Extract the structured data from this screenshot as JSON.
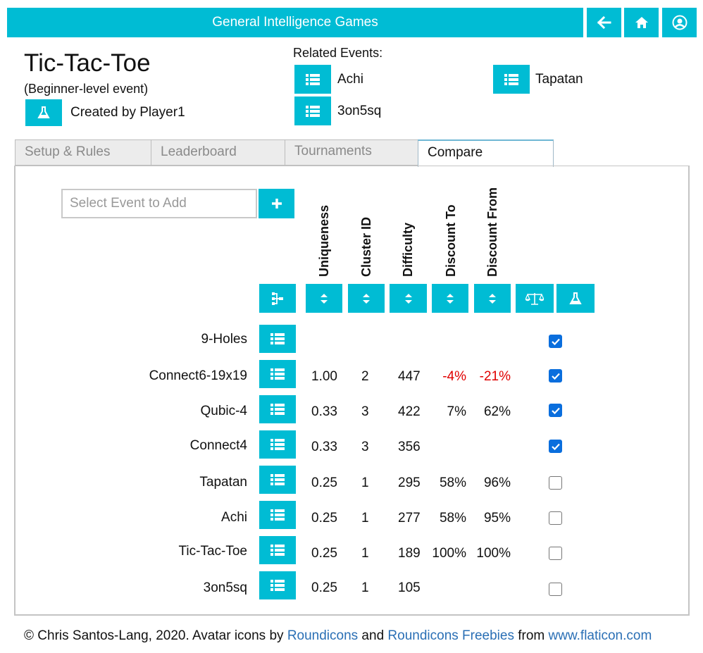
{
  "header": {
    "title": "General Intelligence Games",
    "icons": [
      "back-arrow-icon",
      "home-icon",
      "user-account-icon"
    ]
  },
  "event": {
    "title": "Tic-Tac-Toe",
    "level": "(Beginner-level event)",
    "creator_text": "Created by Player1",
    "creator_icon": "flask-icon"
  },
  "related": {
    "label": "Related Events:",
    "items": [
      {
        "name": "Achi"
      },
      {
        "name": "Tapatan"
      },
      {
        "name": "3on5sq"
      }
    ]
  },
  "tabs": [
    {
      "label": "Setup & Rules"
    },
    {
      "label": "Leaderboard"
    },
    {
      "label": "Tournaments"
    },
    {
      "label": "Compare",
      "active": true
    }
  ],
  "compare": {
    "search_placeholder": "Select Event to Add",
    "add_icon": "plus-icon",
    "columns": [
      "Uniqueness",
      "Cluster ID",
      "Difficulty",
      "Discount To",
      "Discount From"
    ],
    "sort_icons": [
      "hierarchy-icon",
      "sort-icon",
      "sort-icon",
      "sort-icon",
      "sort-icon",
      "sort-icon",
      "balance-scale-icon",
      "flask-icon"
    ],
    "rows": [
      {
        "name": "9-Holes",
        "uniqueness": "",
        "cluster": "",
        "difficulty": "",
        "discount_to": "",
        "discount_from": "",
        "checked": true
      },
      {
        "name": "Connect6-19x19",
        "uniqueness": "1.00",
        "cluster": "2",
        "difficulty": "447",
        "discount_to": "-4%",
        "discount_from": "-21%",
        "checked": true
      },
      {
        "name": "Qubic-4",
        "uniqueness": "0.33",
        "cluster": "3",
        "difficulty": "422",
        "discount_to": "7%",
        "discount_from": "62%",
        "checked": true
      },
      {
        "name": "Connect4",
        "uniqueness": "0.33",
        "cluster": "3",
        "difficulty": "356",
        "discount_to": "",
        "discount_from": "",
        "checked": true
      },
      {
        "name": "Tapatan",
        "uniqueness": "0.25",
        "cluster": "1",
        "difficulty": "295",
        "discount_to": "58%",
        "discount_from": "96%",
        "checked": false
      },
      {
        "name": "Achi",
        "uniqueness": "0.25",
        "cluster": "1",
        "difficulty": "277",
        "discount_to": "58%",
        "discount_from": "95%",
        "checked": false
      },
      {
        "name": "Tic-Tac-Toe",
        "uniqueness": "0.25",
        "cluster": "1",
        "difficulty": "189",
        "discount_to": "100%",
        "discount_from": "100%",
        "checked": false
      },
      {
        "name": "3on5sq",
        "uniqueness": "0.25",
        "cluster": "1",
        "difficulty": "105",
        "discount_to": "",
        "discount_from": "",
        "checked": false
      }
    ]
  },
  "footer": {
    "prefix": "© Chris Santos-Lang, 2020. Avatar icons by ",
    "link1": "Roundicons",
    "and": " and ",
    "link2": "Roundicons Freebies",
    "from": " from ",
    "link3": "www.flaticon.com"
  },
  "colors": {
    "accent": "#00bcd4",
    "negative": "#e00000",
    "checkbox": "#0a6edd"
  }
}
